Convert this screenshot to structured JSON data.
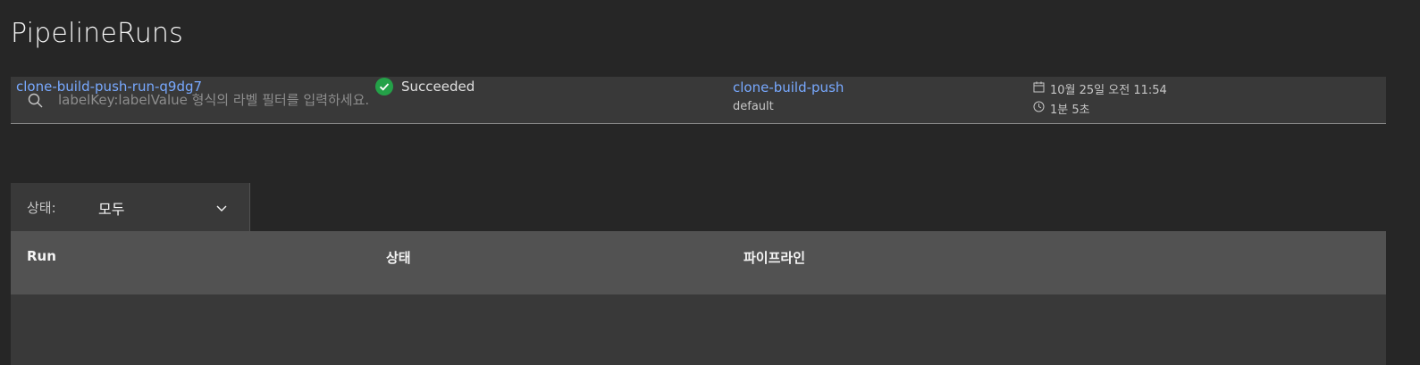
{
  "page": {
    "title": "PipelineRuns"
  },
  "search": {
    "placeholder": "labelKey:labelValue 형식의 라벨 필터를 입력하세요.",
    "icon": "search-icon"
  },
  "filter": {
    "label": "상태:",
    "selected": "모두",
    "icon": "chevron-down-icon"
  },
  "table": {
    "headers": [
      "Run",
      "상태",
      "파이프라인",
      ""
    ],
    "rows": [
      {
        "run": "clone-build-push-run-q9dg7",
        "status": "Succeeded",
        "status_icon": "check-circle-icon",
        "pipeline": "clone-build-push",
        "namespace": "default",
        "date": "10월 25일 오전 11:54",
        "duration": "1분 5초"
      }
    ]
  },
  "colors": {
    "background": "#262626",
    "surface": "#393939",
    "header": "#525252",
    "link": "#78a9ff",
    "success": "#24a148"
  }
}
